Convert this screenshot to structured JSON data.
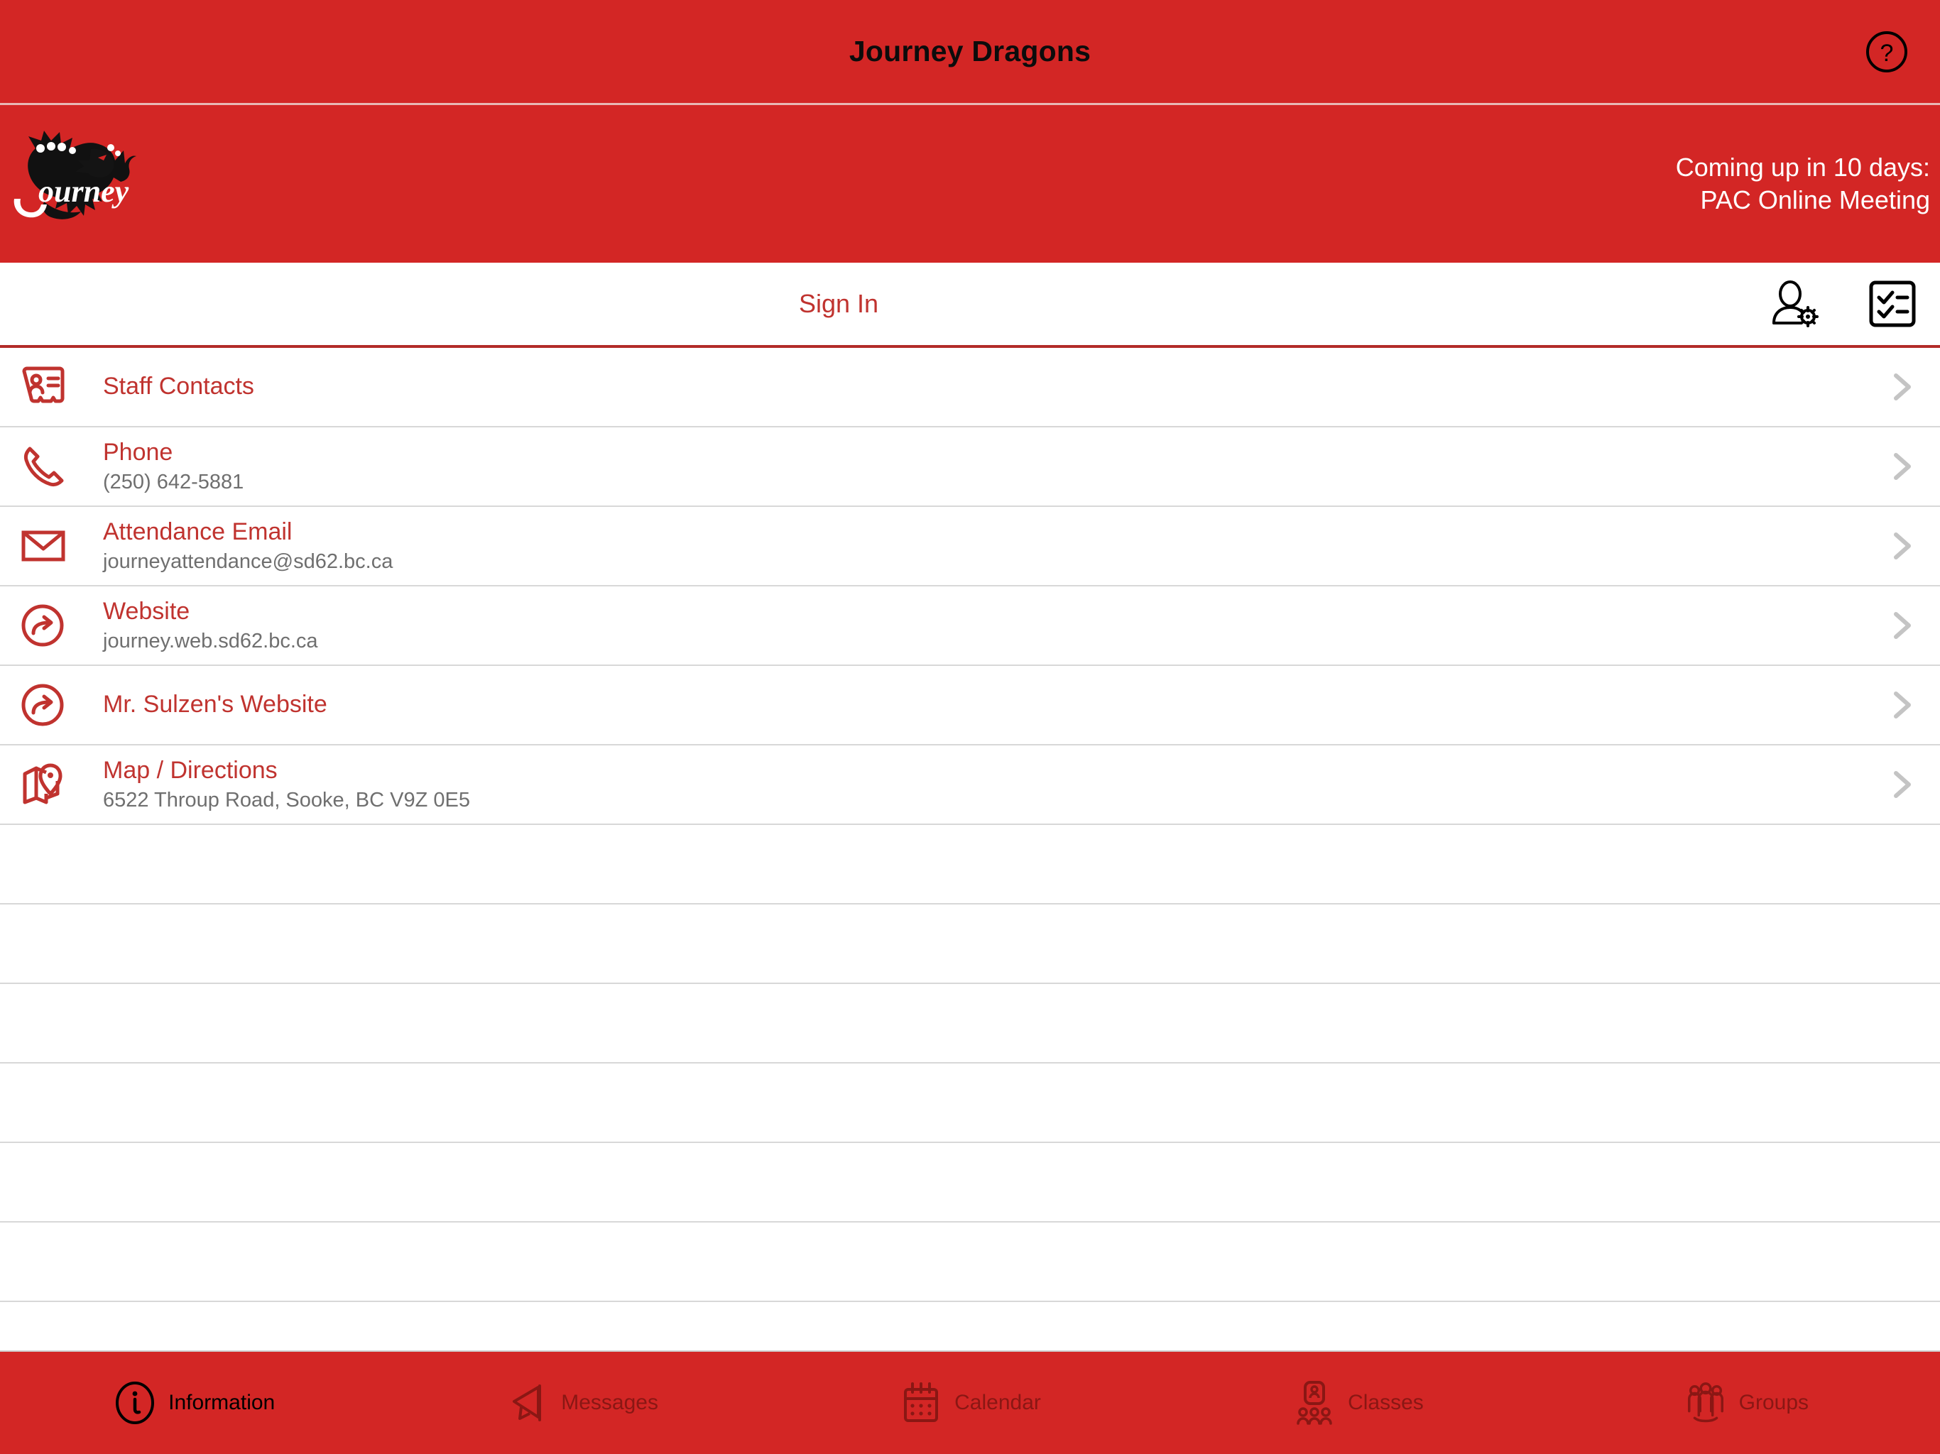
{
  "colors": {
    "brand_red": "#D32625",
    "link_red": "#C0332F",
    "inactive_tab": "#8A1714",
    "sub_gray": "#6f6f6f",
    "separator": "#d8d8d8"
  },
  "titlebar": {
    "title": "Journey Dragons",
    "help_icon": "help-circle-icon"
  },
  "banner": {
    "logo_alt": "Journey Dragons logo",
    "upcoming_line1": "Coming up in 10 days:",
    "upcoming_line2": "PAC Online Meeting"
  },
  "signin_bar": {
    "sign_in_label": "Sign In",
    "account_icon": "user-settings-icon",
    "checklist_icon": "checklist-icon"
  },
  "list": {
    "items": [
      {
        "icon": "id-card-icon",
        "title": "Staff Contacts",
        "subtitle": ""
      },
      {
        "icon": "phone-icon",
        "title": "Phone",
        "subtitle": "(250) 642-5881"
      },
      {
        "icon": "envelope-icon",
        "title": "Attendance Email",
        "subtitle": "journeyattendance@sd62.bc.ca"
      },
      {
        "icon": "external-link-icon",
        "title": "Website",
        "subtitle": "journey.web.sd62.bc.ca"
      },
      {
        "icon": "external-link-icon",
        "title": "Mr. Sulzen's Website",
        "subtitle": ""
      },
      {
        "icon": "map-pin-icon",
        "title": "Map / Directions",
        "subtitle": "6522 Throup Road, Sooke, BC V9Z 0E5"
      }
    ],
    "chevron_icon": "chevron-right-icon",
    "empty_row_count": 7
  },
  "tabbar": {
    "tabs": [
      {
        "label": "Information",
        "icon": "info-circle-icon",
        "active": true
      },
      {
        "label": "Messages",
        "icon": "megaphone-icon",
        "active": false
      },
      {
        "label": "Calendar",
        "icon": "calendar-icon",
        "active": false
      },
      {
        "label": "Classes",
        "icon": "classes-icon",
        "active": false
      },
      {
        "label": "Groups",
        "icon": "groups-icon",
        "active": false
      }
    ]
  }
}
